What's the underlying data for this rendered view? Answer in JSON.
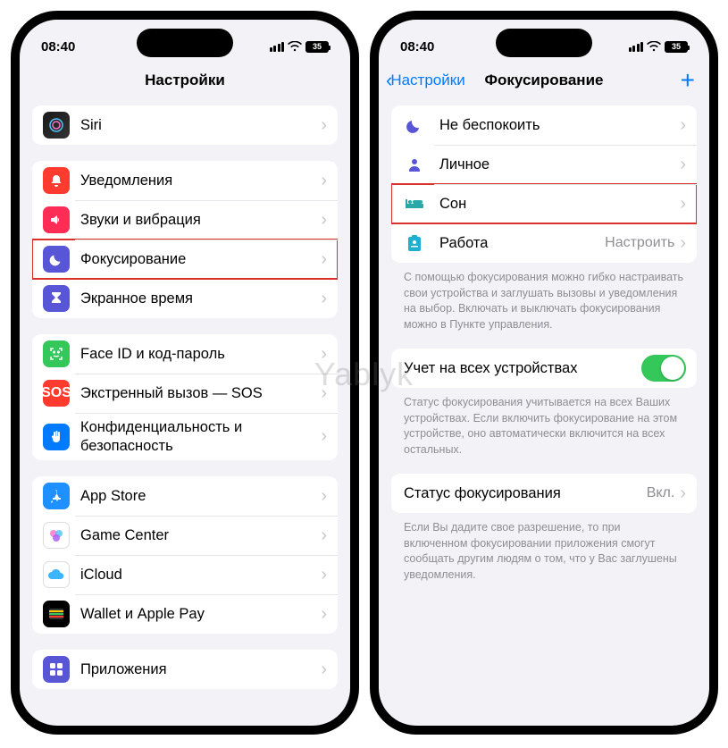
{
  "watermark": "Yablyk",
  "status": {
    "time": "08:40",
    "battery": "35"
  },
  "left": {
    "title": "Настройки",
    "groups": [
      {
        "rows": [
          {
            "icon": "siri",
            "label": "Siri"
          }
        ]
      },
      {
        "rows": [
          {
            "icon": "bell",
            "label": "Уведомления"
          },
          {
            "icon": "sound",
            "label": "Звуки и вибрация"
          },
          {
            "icon": "moon",
            "label": "Фокусирование",
            "highlight": true
          },
          {
            "icon": "hourglass",
            "label": "Экранное время"
          }
        ]
      },
      {
        "rows": [
          {
            "icon": "faceid",
            "label": "Face ID и код-пароль"
          },
          {
            "icon": "sos",
            "label": "Экстренный вызов — SOS"
          },
          {
            "icon": "privacy",
            "label": "Конфиденциальность и безопасность"
          }
        ]
      },
      {
        "rows": [
          {
            "icon": "appstore",
            "label": "App Store"
          },
          {
            "icon": "gamecenter",
            "label": "Game Center"
          },
          {
            "icon": "icloud",
            "label": "iCloud"
          },
          {
            "icon": "wallet",
            "label": "Wallet и Apple Pay"
          }
        ]
      },
      {
        "rows": [
          {
            "icon": "apps",
            "label": "Приложения"
          }
        ]
      }
    ]
  },
  "right": {
    "back": "Настройки",
    "title": "Фокусирование",
    "focusModes": [
      {
        "icon": "moon-outline",
        "label": "Не беспокоить"
      },
      {
        "icon": "person",
        "label": "Личное"
      },
      {
        "icon": "bed",
        "label": "Сон",
        "highlight": true
      },
      {
        "icon": "badge",
        "label": "Работа",
        "detail": "Настроить"
      }
    ],
    "focusNote": "С помощью фокусирования можно гибко настраивать свои устройства и заглушать вызовы и уведомления на выбор. Включать и выключать фокусирования можно в Пункте управления.",
    "shareLabel": "Учет на всех устройствах",
    "shareNote": "Статус фокусирования учитывается на всех Ваших устройствах. Если включить фокусирование на этом устройстве, оно автоматически включится на всех остальных.",
    "statusLabel": "Статус фокусирования",
    "statusValue": "Вкл.",
    "statusNote": "Если Вы дадите свое разрешение, то при включенном фокусировании приложения смогут сообщать другим людям о том, что у Вас заглушены уведомления."
  }
}
